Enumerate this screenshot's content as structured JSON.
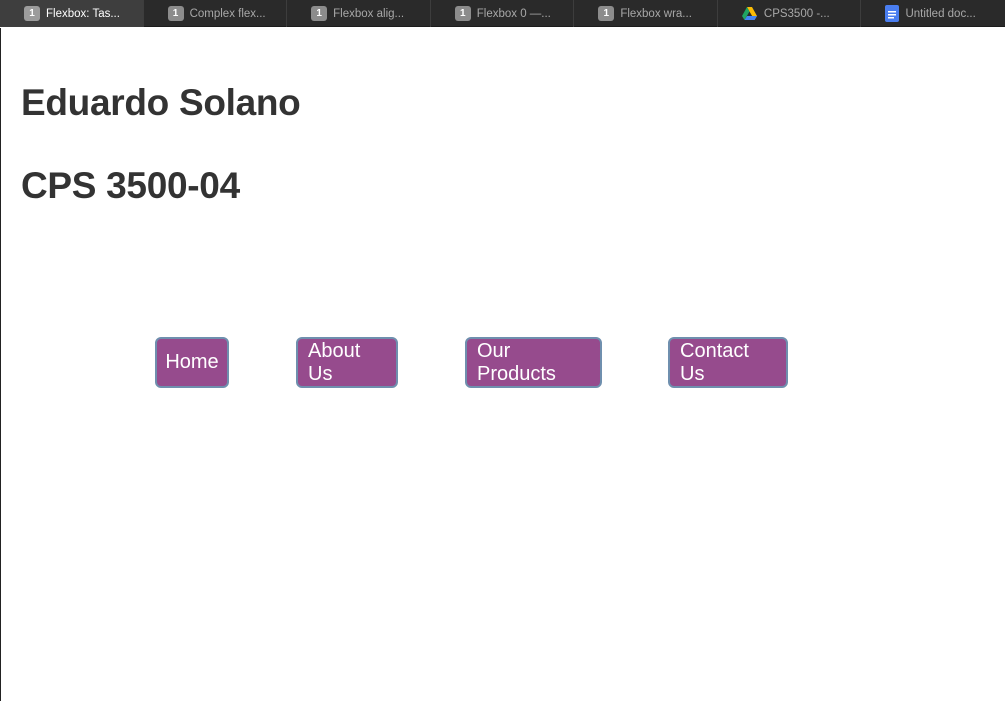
{
  "tabs": [
    {
      "icon": "1",
      "title": "Flexbox: Tas...",
      "active": true
    },
    {
      "icon": "1",
      "title": "Complex flex..."
    },
    {
      "icon": "1",
      "title": "Flexbox alig..."
    },
    {
      "icon": "1",
      "title": "Flexbox 0 —..."
    },
    {
      "icon": "1",
      "title": "Flexbox wra..."
    },
    {
      "icon": "",
      "title": "CPS3500 -..."
    },
    {
      "icon": "",
      "title": "Untitled doc..."
    }
  ],
  "page": {
    "name": "Eduardo Solano",
    "course": "CPS 3500-04"
  },
  "nav": {
    "home": "Home",
    "about": "About Us",
    "products": "Our Products",
    "contact": "Contact Us"
  },
  "colors": {
    "button_bg": "#964b8d",
    "button_border": "#6f8fae",
    "heading": "#333333",
    "tabbar": "#2a2a2a"
  }
}
